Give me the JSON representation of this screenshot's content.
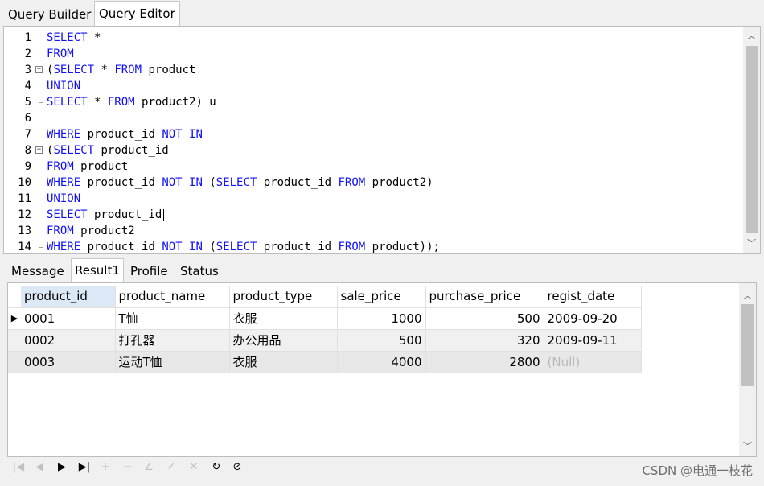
{
  "tabs": [
    "Query Builder",
    "Query Editor"
  ],
  "active_tab": "Query Editor",
  "editor": {
    "lines": [
      {
        "n": "1",
        "tokens": [
          [
            "SELECT",
            "kw"
          ],
          [
            " *",
            ""
          ]
        ]
      },
      {
        "n": "2",
        "tokens": [
          [
            "FROM",
            "kw"
          ]
        ]
      },
      {
        "n": "3",
        "fold": "start",
        "tokens": [
          [
            "(",
            ""
          ],
          [
            "SELECT",
            "kw"
          ],
          [
            " * ",
            ""
          ],
          [
            "FROM",
            "kw"
          ],
          [
            " product",
            ""
          ]
        ]
      },
      {
        "n": "4",
        "tokens": [
          [
            "UNION",
            "kw"
          ]
        ]
      },
      {
        "n": "5",
        "fold": "end",
        "tokens": [
          [
            "SELECT",
            "kw"
          ],
          [
            " * ",
            ""
          ],
          [
            "FROM",
            "kw"
          ],
          [
            " product2) u",
            ""
          ]
        ]
      },
      {
        "n": "6",
        "tokens": []
      },
      {
        "n": "7",
        "tokens": [
          [
            "WHERE",
            "kw"
          ],
          [
            " product_id ",
            ""
          ],
          [
            "NOT",
            "kw"
          ],
          [
            " ",
            ""
          ],
          [
            "IN",
            "kw"
          ]
        ]
      },
      {
        "n": "8",
        "fold": "start",
        "tokens": [
          [
            "(",
            ""
          ],
          [
            "SELECT",
            "kw"
          ],
          [
            " product_id",
            ""
          ]
        ]
      },
      {
        "n": "9",
        "tokens": [
          [
            "FROM",
            "kw"
          ],
          [
            " product",
            ""
          ]
        ]
      },
      {
        "n": "10",
        "tokens": [
          [
            "WHERE",
            "kw"
          ],
          [
            " product_id ",
            ""
          ],
          [
            "NOT",
            "kw"
          ],
          [
            " ",
            ""
          ],
          [
            "IN",
            "kw"
          ],
          [
            " (",
            ""
          ],
          [
            "SELECT",
            "kw"
          ],
          [
            " product_id ",
            ""
          ],
          [
            "FROM",
            "kw"
          ],
          [
            " product2)",
            ""
          ]
        ]
      },
      {
        "n": "11",
        "tokens": [
          [
            "UNION",
            "kw"
          ]
        ]
      },
      {
        "n": "12",
        "caret": true,
        "tokens": [
          [
            "SELECT",
            "kw"
          ],
          [
            " product_id",
            ""
          ]
        ]
      },
      {
        "n": "13",
        "tokens": [
          [
            "FROM",
            "kw"
          ],
          [
            " product2",
            ""
          ]
        ]
      },
      {
        "n": "14",
        "fold": "end",
        "tokens": [
          [
            "WHERE",
            "kw"
          ],
          [
            " product id ",
            ""
          ],
          [
            "NOT",
            "kw"
          ],
          [
            " ",
            ""
          ],
          [
            "IN",
            "kw"
          ],
          [
            " (",
            ""
          ],
          [
            "SELECT",
            "kw"
          ],
          [
            " product id ",
            ""
          ],
          [
            "FROM",
            "kw"
          ],
          [
            " product));",
            ""
          ]
        ]
      }
    ]
  },
  "result_tabs": [
    "Message",
    "Result1",
    "Profile",
    "Status"
  ],
  "active_result_tab": "Result1",
  "grid": {
    "columns": [
      "product_id",
      "product_name",
      "product_type",
      "sale_price",
      "purchase_price",
      "regist_date"
    ],
    "rows": [
      [
        "0001",
        "T恤",
        "衣服",
        "1000",
        "500",
        "2009-09-20"
      ],
      [
        "0002",
        "打孔器",
        "办公用品",
        "500",
        "320",
        "2009-09-11"
      ],
      [
        "0003",
        "运动T恤",
        "衣服",
        "4000",
        "2800",
        "(Null)"
      ]
    ]
  },
  "nav_buttons": [
    {
      "name": "first-record-icon",
      "glyph": "|◀",
      "enabled": false
    },
    {
      "name": "prev-record-icon",
      "glyph": "◀",
      "enabled": false
    },
    {
      "name": "next-record-icon",
      "glyph": "▶",
      "enabled": true
    },
    {
      "name": "last-record-icon",
      "glyph": "▶|",
      "enabled": true
    },
    {
      "name": "insert-record-icon",
      "glyph": "+",
      "enabled": false
    },
    {
      "name": "delete-record-icon",
      "glyph": "−",
      "enabled": false
    },
    {
      "name": "edit-record-icon",
      "glyph": "∠",
      "enabled": false
    },
    {
      "name": "apply-changes-icon",
      "glyph": "✓",
      "enabled": false
    },
    {
      "name": "cancel-changes-icon",
      "glyph": "✕",
      "enabled": false
    },
    {
      "name": "refresh-icon",
      "glyph": "↻",
      "enabled": true
    },
    {
      "name": "stop-icon",
      "glyph": "⊘",
      "enabled": true
    }
  ],
  "watermark": "CSDN @电通一枝花"
}
